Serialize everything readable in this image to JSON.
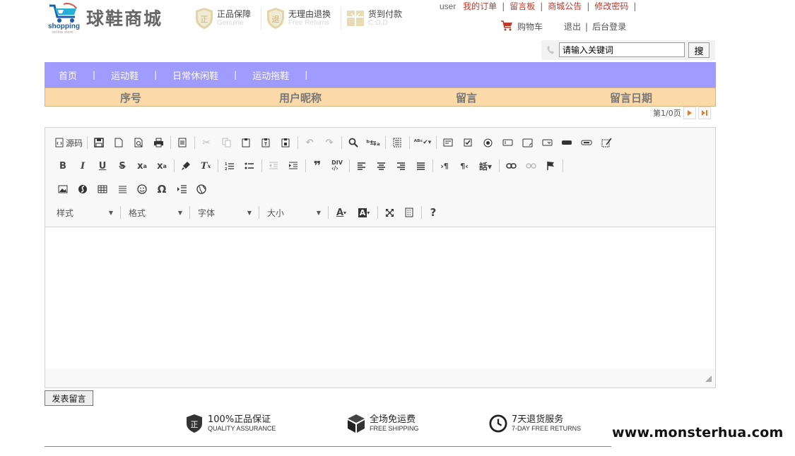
{
  "brand": {
    "logo_word": "shopping",
    "logo_sub": "online store",
    "site_name": "球鞋商城"
  },
  "promos": [
    {
      "title": "正品保障",
      "subtitle": "Genuine",
      "icon": "shield-zheng-icon"
    },
    {
      "title": "无理由退换",
      "subtitle": "Free Returns",
      "icon": "shield-tui-icon"
    },
    {
      "title": "货到付款",
      "subtitle": "C.O.D",
      "icon": "box-cod-icon"
    }
  ],
  "top_links": {
    "username": "user",
    "my_orders": "我的订单",
    "message_board": "留言板",
    "announcements": "商城公告",
    "change_password": "修改密码"
  },
  "account_links": {
    "cart": "购物车",
    "logout": "退出",
    "admin_login": "后台登录"
  },
  "search": {
    "value": "请输入关键词",
    "button": "搜"
  },
  "nav": [
    "首页",
    "运动鞋",
    "日常休闲鞋",
    "运动拖鞋"
  ],
  "table": {
    "columns": [
      "序号",
      "用户昵称",
      "留言",
      "留言日期"
    ]
  },
  "pager": {
    "text": "第1/0页"
  },
  "editor": {
    "source_label": "源码",
    "combos": [
      "样式",
      "格式",
      "字体",
      "大小"
    ],
    "content": ""
  },
  "submit_label": "发表留言",
  "features": [
    {
      "title": "100%正品保证",
      "subtitle": "QUALITY ASSURANCE",
      "icon": "shield-check-icon"
    },
    {
      "title": "全场免运费",
      "subtitle": "FREE SHIPPING",
      "icon": "package-icon"
    },
    {
      "title": "7天退货服务",
      "subtitle": "7-DAY FREE RETURNS",
      "icon": "clock-icon"
    }
  ],
  "watermark": "www.monsterhua.com",
  "colors": {
    "nav_bg": "#9f9bff",
    "table_header_bg": "#fbd9a9",
    "link_red": "#c0392b"
  }
}
